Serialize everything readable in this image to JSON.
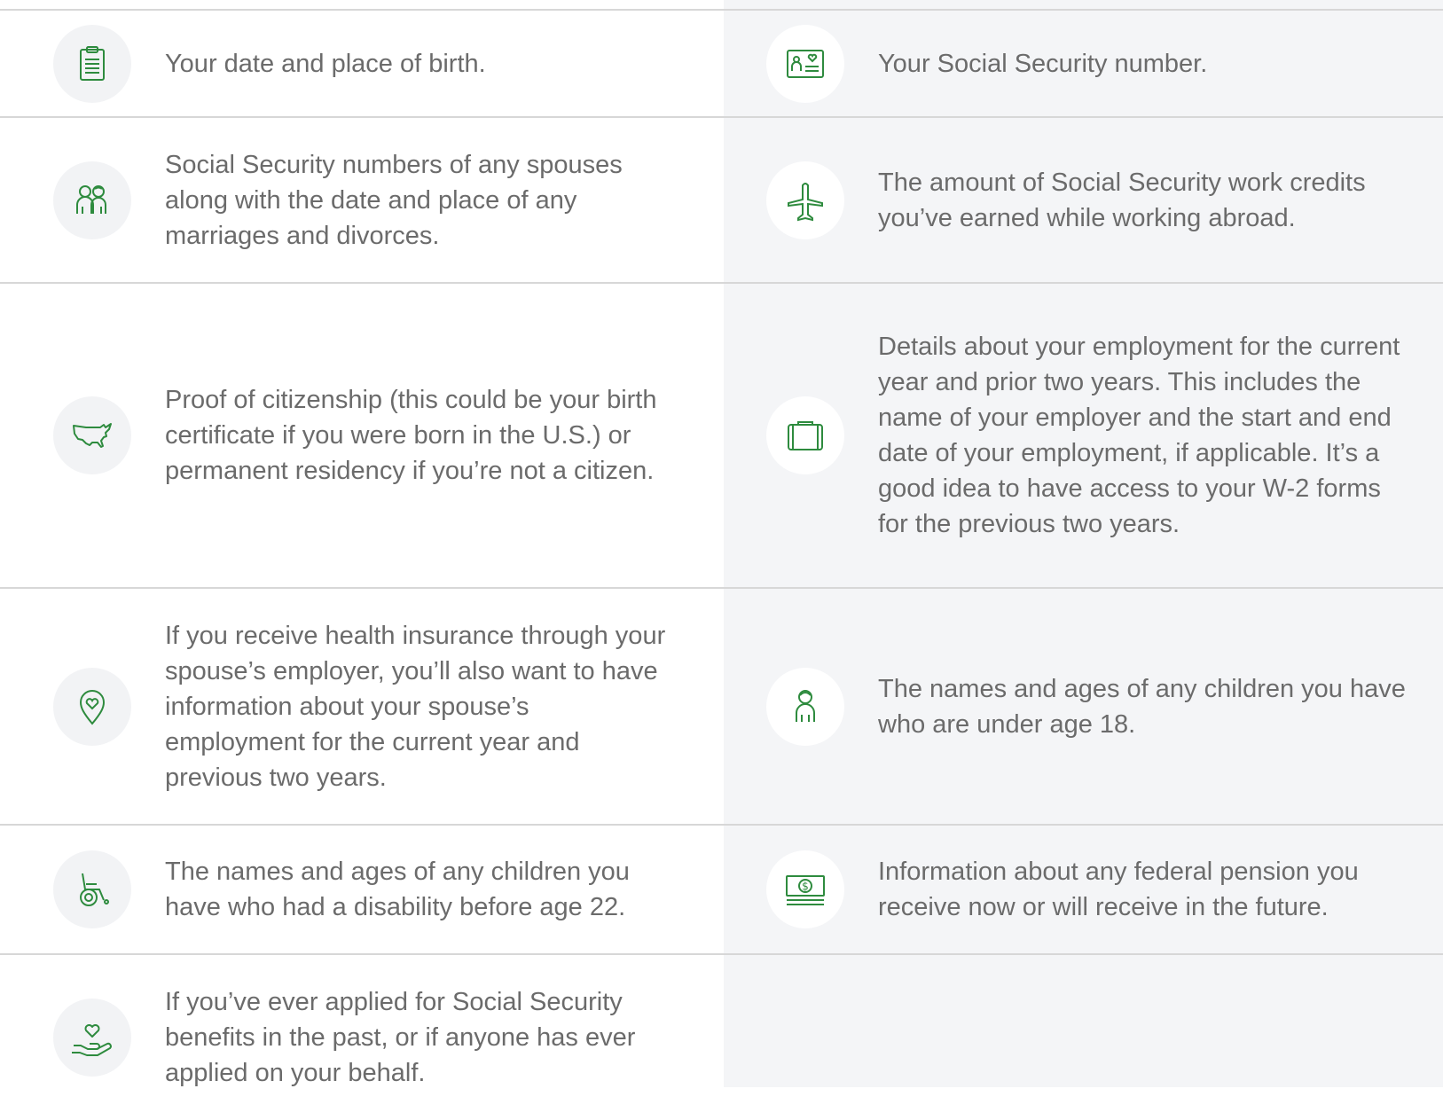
{
  "colors": {
    "icon": "#2e8b3e",
    "text": "#6b6b6b",
    "divider": "#d7d7d7",
    "right_column_bg": "#f4f5f7"
  },
  "rows": [
    {
      "left": {
        "icon": "clipboard-icon",
        "text": "Your date and place of birth."
      },
      "right": {
        "icon": "id-card-icon",
        "text": "Your Social Security number."
      }
    },
    {
      "left": {
        "icon": "couple-icon",
        "text": "Social Security numbers of any spouses along with the date and place of any marriages and divorces."
      },
      "right": {
        "icon": "airplane-icon",
        "text": "The amount of Social Security work credits you’ve earned while working abroad."
      }
    },
    {
      "left": {
        "icon": "usa-map-icon",
        "text": "Proof of citizenship (this could be your birth certificate if you were born in the U.S.) or permanent residency if you’re not a citizen."
      },
      "right": {
        "icon": "briefcase-icon",
        "text": "Details about your employment for the current year and prior two years. This includes the name of your employer and the start and end date of your employment, if applicable. It’s a good idea to have access to your W-2 forms for the previous two years."
      }
    },
    {
      "left": {
        "icon": "location-heart-icon",
        "text": "If you receive health insurance through your spouse’s employer, you’ll also want to have information about your spouse’s employment for the current year and previous two years."
      },
      "right": {
        "icon": "child-icon",
        "text": "The names and ages of any children you have who are under age 18."
      }
    },
    {
      "left": {
        "icon": "wheelchair-icon",
        "text": "The names and ages of any children you have who had a disability before age 22."
      },
      "right": {
        "icon": "dollar-bill-icon",
        "text": "Information about any federal pension you receive now or will receive in the future."
      }
    },
    {
      "left": {
        "icon": "hand-heart-icon",
        "text": "If you’ve ever applied for Social Security benefits in the past, or if anyone has ever applied on your behalf."
      }
    }
  ]
}
